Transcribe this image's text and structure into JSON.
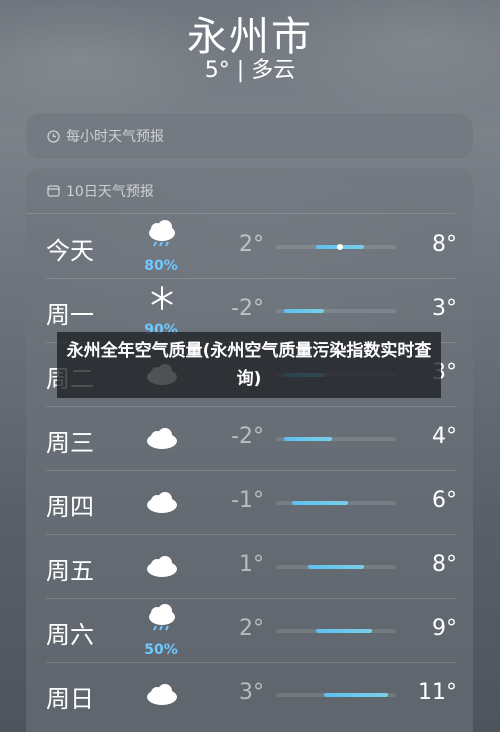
{
  "city": "永州市",
  "summary": "5° | 多云",
  "hourly": {
    "title": "每小时天气预报",
    "icon": "clock-icon"
  },
  "tenday": {
    "title": "10日天气预报",
    "icon": "calendar-icon",
    "days": [
      {
        "day": "今天",
        "icon": "rain-cloud-icon",
        "pct": "80%",
        "low": "2°",
        "high": "8°",
        "range": [
          2,
          8
        ],
        "current": 5
      },
      {
        "day": "周一",
        "icon": "snowflake-icon",
        "pct": "90%",
        "low": "-2°",
        "high": "3°",
        "range": [
          -2,
          3
        ]
      },
      {
        "day": "周二",
        "icon": "cloud-icon",
        "pct": "",
        "low": "",
        "high": "3°",
        "range": [
          -2,
          3
        ]
      },
      {
        "day": "周三",
        "icon": "cloud-icon",
        "pct": "",
        "low": "-2°",
        "high": "4°",
        "range": [
          -2,
          4
        ]
      },
      {
        "day": "周四",
        "icon": "cloud-icon",
        "pct": "",
        "low": "-1°",
        "high": "6°",
        "range": [
          -1,
          6
        ]
      },
      {
        "day": "周五",
        "icon": "cloud-icon",
        "pct": "",
        "low": "1°",
        "high": "8°",
        "range": [
          1,
          8
        ]
      },
      {
        "day": "周六",
        "icon": "rain-cloud-icon",
        "pct": "50%",
        "low": "2°",
        "high": "9°",
        "range": [
          2,
          9
        ]
      },
      {
        "day": "周日",
        "icon": "cloud-icon",
        "pct": "",
        "low": "3°",
        "high": "11°",
        "range": [
          3,
          11
        ]
      }
    ]
  },
  "banner": "永州全年空气质量(永州空气质量污染指数实时查询)",
  "colors": {
    "accent": "#6fc8ff",
    "bar": "#5fc0f0"
  }
}
